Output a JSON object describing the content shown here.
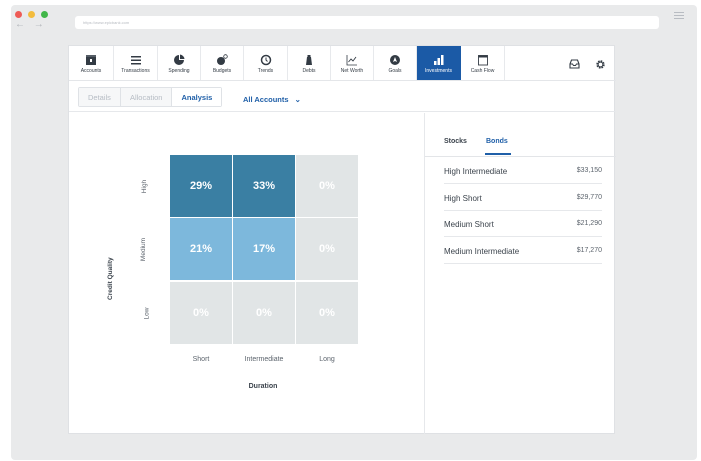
{
  "browser": {
    "url": "https://www.epicbank.com",
    "back_glyph": "←",
    "forward_glyph": "→"
  },
  "topnav": {
    "items": [
      {
        "label": "Accounts",
        "icon": "accounts-icon"
      },
      {
        "label": "Transactions",
        "icon": "transactions-icon"
      },
      {
        "label": "Spending",
        "icon": "spending-icon"
      },
      {
        "label": "Budgets",
        "icon": "budgets-icon"
      },
      {
        "label": "Trends",
        "icon": "trends-icon"
      },
      {
        "label": "Debts",
        "icon": "debts-icon"
      },
      {
        "label": "Net Worth",
        "icon": "net-worth-icon"
      },
      {
        "label": "Goals",
        "icon": "goals-icon"
      },
      {
        "label": "Investments",
        "icon": "investments-icon",
        "active": true
      },
      {
        "label": "Cash Flow",
        "icon": "cash-flow-icon"
      }
    ],
    "active_color": "#1b5aa6"
  },
  "subnav": {
    "tabs": [
      "Details",
      "Allocation",
      "Analysis"
    ],
    "active_tab": "Analysis",
    "account_filter": "All Accounts",
    "filter_chevron": "⌄"
  },
  "chart_data": {
    "type": "heatmap",
    "ylabel": "Credit Quality",
    "xlabel": "Duration",
    "rows": [
      "High",
      "Medium",
      "Low"
    ],
    "columns": [
      "Short",
      "Intermediate",
      "Long"
    ],
    "values": [
      [
        29,
        33,
        0
      ],
      [
        21,
        17,
        0
      ],
      [
        0,
        0,
        0
      ]
    ],
    "labels": [
      [
        "29%",
        "33%",
        "0%"
      ],
      [
        "21%",
        "17%",
        "0%"
      ],
      [
        "0%",
        "0%",
        "0%"
      ]
    ],
    "colors": {
      "high": "#3a7fa3",
      "medium": "#7db8dc",
      "empty": "#e1e5e6"
    }
  },
  "holdings": {
    "tabs": [
      "Stocks",
      "Bonds"
    ],
    "active_tab": "Bonds",
    "rows": [
      {
        "name": "High Intermediate",
        "amount": "$33,150"
      },
      {
        "name": "High Short",
        "amount": "$29,770"
      },
      {
        "name": "Medium Short",
        "amount": "$21,290"
      },
      {
        "name": "Medium Intermediate",
        "amount": "$17,270"
      }
    ]
  }
}
